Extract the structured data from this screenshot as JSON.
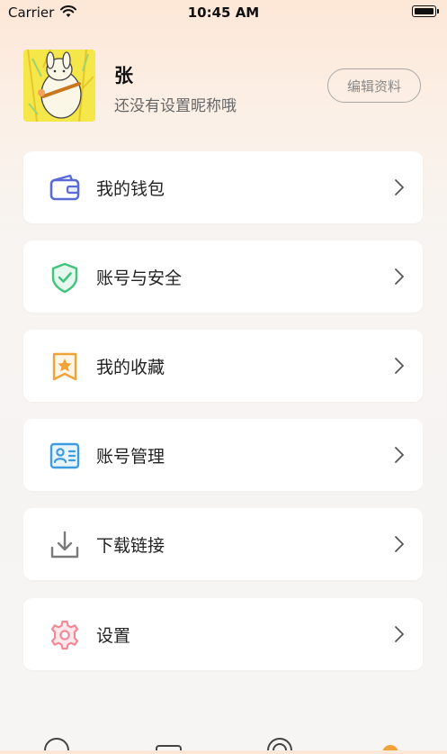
{
  "status_bar": {
    "carrier": "Carrier",
    "time": "10:45 AM"
  },
  "profile": {
    "name": "张",
    "subtitle": "还没有设置昵称哦",
    "edit_label": "编辑资料"
  },
  "menu": [
    {
      "label": "我的钱包",
      "icon": "wallet-icon",
      "color": "#5b6bd6"
    },
    {
      "label": "账号与安全",
      "icon": "shield-check-icon",
      "color": "#3fc47a"
    },
    {
      "label": "我的收藏",
      "icon": "favorite-star-icon",
      "color": "#f0a338"
    },
    {
      "label": "账号管理",
      "icon": "id-card-icon",
      "color": "#3d9be0"
    },
    {
      "label": "下载链接",
      "icon": "download-icon",
      "color": "#7a7a7a"
    },
    {
      "label": "设置",
      "icon": "gear-icon",
      "color": "#f08a97"
    }
  ],
  "colors": {
    "accent": "#f0a338",
    "background_top": "#fde7d7",
    "background_bottom": "#f6f5f4"
  }
}
